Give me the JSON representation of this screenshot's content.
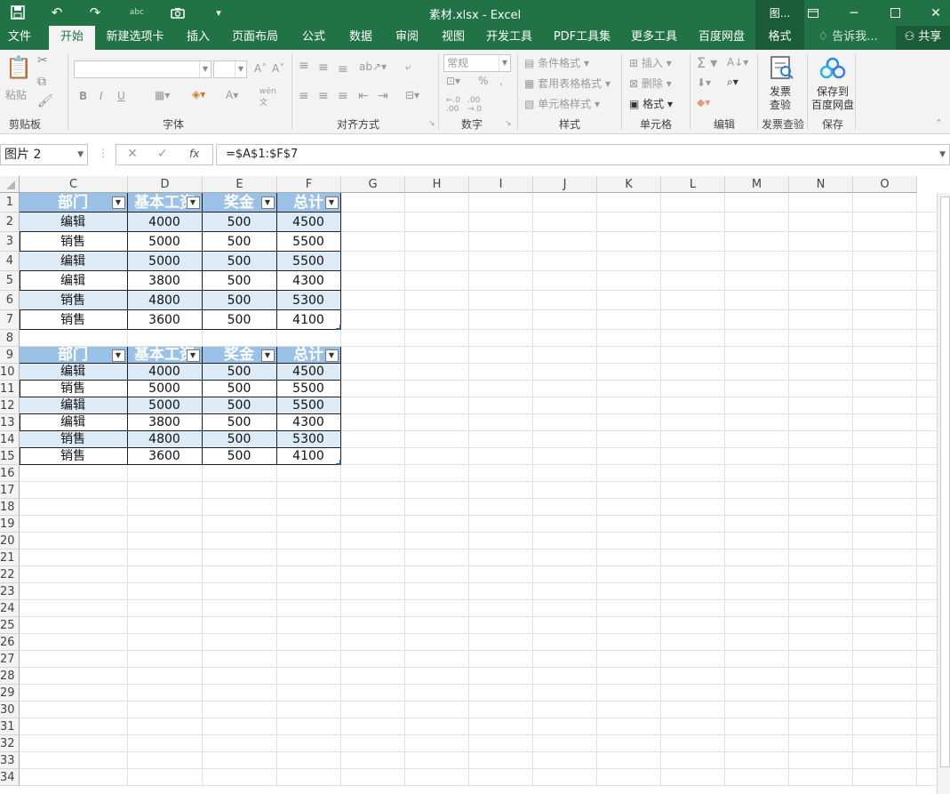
{
  "titlebar": {
    "title": "素材.xlsx - Excel",
    "context_tab": "图...",
    "icons": [
      "save-icon",
      "undo-icon",
      "redo-icon",
      "spelling-icon",
      "camera-icon",
      "customize-icon"
    ],
    "window_controls": [
      "ribbon-display-icon",
      "minimize-icon",
      "restore-icon",
      "close-icon"
    ]
  },
  "tabs": {
    "items": [
      "文件",
      "开始",
      "新建选项卡",
      "插入",
      "页面布局",
      "公式",
      "数据",
      "审阅",
      "视图",
      "开发工具",
      "PDF工具集",
      "更多工具",
      "百度网盘",
      "格式"
    ],
    "active": "开始",
    "tell_me": "告诉我...",
    "share": "共享"
  },
  "ribbon": {
    "clipboard": {
      "label": "剪贴板",
      "paste": "粘贴"
    },
    "font": {
      "label": "字体",
      "bold": "B",
      "italic": "I",
      "underline": "U",
      "font_name": "",
      "font_size": ""
    },
    "alignment": {
      "label": "对齐方式"
    },
    "number": {
      "label": "数字",
      "format": "常规"
    },
    "styles": {
      "label": "样式",
      "conditional": "条件格式",
      "table_format": "套用表格格式",
      "cell_styles": "单元格样式"
    },
    "cells": {
      "label": "单元格",
      "insert": "插入",
      "delete": "删除",
      "format": "格式"
    },
    "editing": {
      "label": "编辑"
    },
    "invoice": {
      "label": "发票查验",
      "button_l1": "发票",
      "button_l2": "查验"
    },
    "save": {
      "label": "保存",
      "button_l1": "保存到",
      "button_l2": "百度网盘"
    }
  },
  "formula_bar": {
    "name_box": "图片 2",
    "formula": "=$A$1:$F$7"
  },
  "columns": [
    "C",
    "D",
    "E",
    "F",
    "G",
    "H",
    "I",
    "J",
    "K",
    "L",
    "M",
    "N",
    "O"
  ],
  "rows": [
    "1",
    "2",
    "3",
    "4",
    "5",
    "6",
    "7",
    "8",
    "9",
    "10",
    "11",
    "12",
    "13",
    "14",
    "15",
    "16",
    "17",
    "18",
    "19",
    "20",
    "21",
    "22",
    "23",
    "24",
    "25",
    "26",
    "27",
    "28",
    "29",
    "30",
    "31",
    "32",
    "33",
    "34"
  ],
  "table1": {
    "headers": [
      "部门",
      "基本工资",
      "奖金",
      "总计"
    ],
    "rows": [
      [
        "编辑",
        "4000",
        "500",
        "4500"
      ],
      [
        "销售",
        "5000",
        "500",
        "5500"
      ],
      [
        "编辑",
        "5000",
        "500",
        "5500"
      ],
      [
        "编辑",
        "3800",
        "500",
        "4300"
      ],
      [
        "销售",
        "4800",
        "500",
        "5300"
      ],
      [
        "销售",
        "3600",
        "500",
        "4100"
      ]
    ]
  },
  "table2": {
    "headers": [
      "部门",
      "基本工资",
      "奖金",
      "总计"
    ],
    "rows": [
      [
        "编辑",
        "4000",
        "500",
        "4500"
      ],
      [
        "销售",
        "5000",
        "500",
        "5500"
      ],
      [
        "编辑",
        "5000",
        "500",
        "5500"
      ],
      [
        "编辑",
        "3800",
        "500",
        "4300"
      ],
      [
        "销售",
        "4800",
        "500",
        "5300"
      ],
      [
        "销售",
        "3600",
        "500",
        "4100"
      ]
    ]
  },
  "colors": {
    "excel_green": "#217346",
    "table_header": "#9bc2e6",
    "table_band": "#ddebf7"
  }
}
